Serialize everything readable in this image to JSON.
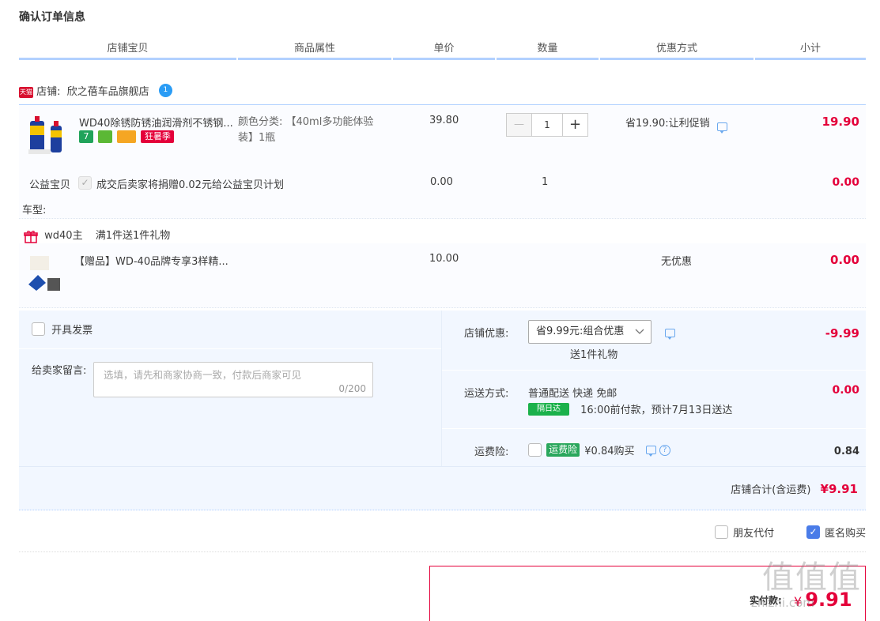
{
  "page": {
    "title": "确认订单信息"
  },
  "columns": [
    "店铺宝贝",
    "商品属性",
    "单价",
    "数量",
    "优惠方式",
    "小计"
  ],
  "shop": {
    "badge": "天猫",
    "label": "店铺:",
    "name": "欣之蓓车品旗舰店",
    "ww": "1"
  },
  "item1": {
    "name": "WD40除锈防锈油润滑剂不锈钢...",
    "tags": [
      "7",
      "",
      "",
      "狂暑季"
    ],
    "attr": "颜色分类: 【40ml多功能体验装】1瓶",
    "price": "39.80",
    "qty": "1",
    "minus": "—",
    "plus": "+",
    "promo": "省19.90:让利促销",
    "subtotal": "19.90"
  },
  "charity": {
    "label": "公益宝贝",
    "text": "成交后卖家将捐赠0.02元给公益宝贝计划",
    "price": "0.00",
    "qty": "1",
    "subtotal": "0.00"
  },
  "car_type": {
    "label": "车型:"
  },
  "gift_group": {
    "prefix": "wd40主",
    "rule": "满1件送1件礼物"
  },
  "gift_item": {
    "name": "【赠品】WD-40品牌专享3样精...",
    "price": "10.00",
    "promo": "无优惠",
    "subtotal": "0.00"
  },
  "invoice": {
    "label": "开具发票"
  },
  "message": {
    "label": "给卖家留言:",
    "placeholder": "选填，请先和商家协商一致，付款后商家可见",
    "counter": "0/200"
  },
  "shop_discount": {
    "label": "店铺优惠:",
    "selected": "省9.99元:组合优惠",
    "note": "送1件礼物",
    "amount": "-9.99"
  },
  "delivery": {
    "label": "运送方式:",
    "method": "普通配送 快递 免邮",
    "badge": "隔日达",
    "eta": "16:00前付款，预计7月13日送达",
    "amount": "0.00"
  },
  "insurance": {
    "label": "运费险:",
    "badge": "运费险",
    "text": "¥0.84购买",
    "amount": "0.84"
  },
  "shop_total": {
    "label": "店铺合计(含运费)",
    "amount": "¥9.91"
  },
  "options": {
    "friend_pay": "朋友代付",
    "anonymous": "匿名购买"
  },
  "payment": {
    "label": "实付款:",
    "currency": "¥",
    "amount": "9.91"
  },
  "watermark": {
    "text": "值值值",
    "site": "zhizhi.com"
  },
  "colors": {
    "accent_red": "#e4003a",
    "header_line": "#b2d1ff",
    "panel_bg": "#f2f7ff"
  }
}
